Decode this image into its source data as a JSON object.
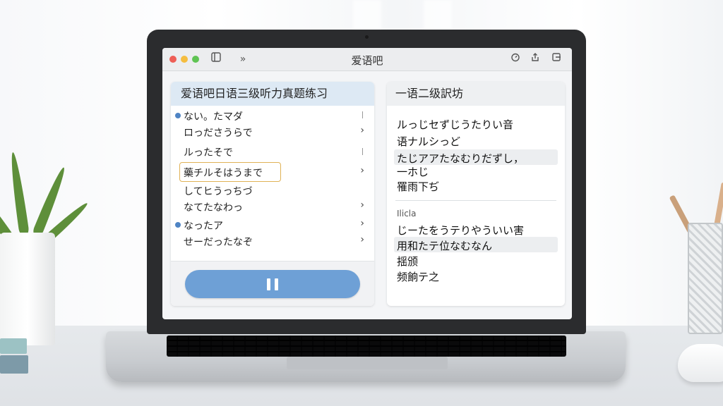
{
  "window": {
    "title": "爱语吧"
  },
  "left_panel": {
    "title": "爱语吧日语三级听力真题练习",
    "items": [
      {
        "text": "ない。たマダ",
        "bullet": true,
        "marker": "bar"
      },
      {
        "text": "ロっださうらで",
        "bullet": false,
        "marker": "chevron"
      },
      {
        "text": "ルったそで",
        "bullet": false,
        "marker": "bar"
      },
      {
        "text": "藥チルそはうまで",
        "bullet": false,
        "marker": "chevron",
        "highlighted": true
      },
      {
        "text": "してヒうっちづ",
        "bullet": false,
        "marker": ""
      },
      {
        "text": "なてたなわっ",
        "bullet": false,
        "marker": "chevron"
      },
      {
        "text": "なったア",
        "bullet": true,
        "marker": "chevron"
      },
      {
        "text": "せーだったなぞ",
        "bullet": false,
        "marker": "chevron"
      }
    ],
    "chevron": "›",
    "pause_icon": "pause-icon"
  },
  "right_panel": {
    "title": "一语二级訳坊",
    "lines_a": [
      "ルっじセずじうたりい音",
      "语ナルシっど",
      "たじアアたなむりだずし，",
      "一ホじ",
      "罹雨下ぢ"
    ],
    "section_label": "Ilicla",
    "lines_b": [
      "じーたをうテりやういい害",
      "用和たテ位なむなん",
      "揺颁",
      "频餉テ之"
    ]
  },
  "colors": {
    "accent": "#6ea0d6",
    "header_blue": "#dde9f4",
    "bullet": "#4f84c4",
    "highlight": "#e0b256",
    "close": "#ee5e56",
    "minimize": "#f5bd3f",
    "zoom": "#5fc453"
  },
  "icons": [
    "sidebar-icon",
    "forward-icon",
    "timer-icon",
    "share-icon",
    "export-icon"
  ]
}
